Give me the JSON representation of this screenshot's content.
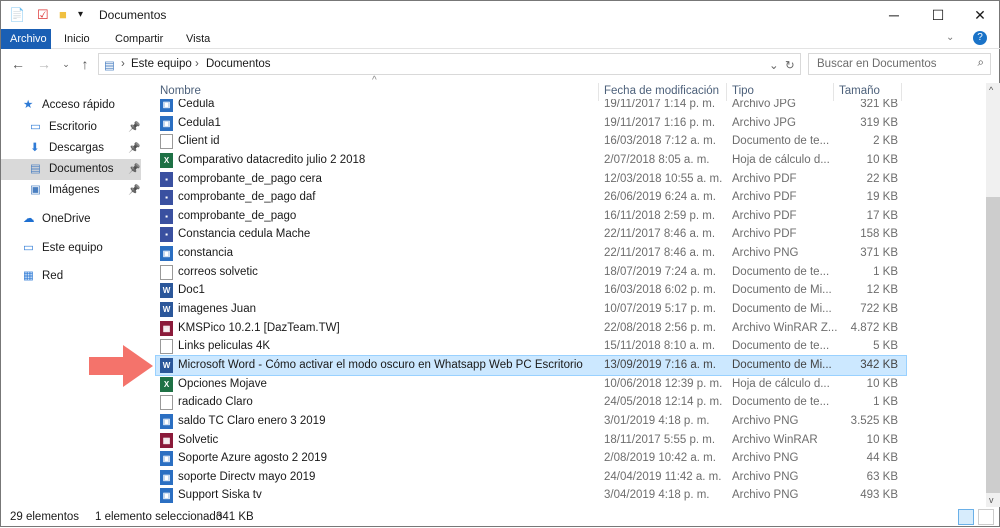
{
  "window": {
    "title": "Documentos",
    "minimize": "─",
    "maximize": "☐",
    "close": "✕",
    "help": "?"
  },
  "ribbon": {
    "tabs": [
      "Archivo",
      "Inicio",
      "Compartir",
      "Vista"
    ]
  },
  "address": {
    "crumbs": [
      "Este equipo",
      "Documentos"
    ],
    "search_placeholder": "Buscar en Documentos"
  },
  "sidebar": {
    "items": [
      {
        "label": "Acceso rápido",
        "icon": "star-icon"
      },
      {
        "label": "Escritorio",
        "icon": "desktop-icon",
        "pinned": true
      },
      {
        "label": "Descargas",
        "icon": "download-icon",
        "pinned": true
      },
      {
        "label": "Documentos",
        "icon": "documents-icon",
        "pinned": true,
        "selected": true
      },
      {
        "label": "Imágenes",
        "icon": "pictures-icon",
        "pinned": true
      },
      {
        "label": "OneDrive",
        "icon": "cloud-icon"
      },
      {
        "label": "Este equipo",
        "icon": "computer-icon"
      },
      {
        "label": "Red",
        "icon": "network-icon"
      }
    ]
  },
  "columns": {
    "name": "Nombre",
    "date": "Fecha de modificación",
    "type": "Tipo",
    "size": "Tamaño"
  },
  "files": [
    {
      "name": "Cedula",
      "date": "19/11/2017 1:14 p. m.",
      "type": "Archivo JPG",
      "size": "321 KB",
      "icon": "jpg"
    },
    {
      "name": "Cedula1",
      "date": "19/11/2017 1:16 p. m.",
      "type": "Archivo JPG",
      "size": "319 KB",
      "icon": "jpg"
    },
    {
      "name": "Client id",
      "date": "16/03/2018 7:12 a. m.",
      "type": "Documento de te...",
      "size": "2 KB",
      "icon": "txt"
    },
    {
      "name": "Comparativo datacredito julio 2 2018",
      "date": "2/07/2018 8:05 a. m.",
      "type": "Hoja de cálculo d...",
      "size": "10 KB",
      "icon": "xls"
    },
    {
      "name": "comprobante_de_pago cera",
      "date": "12/03/2018 10:55 a. m.",
      "type": "Archivo PDF",
      "size": "22 KB",
      "icon": "pdf"
    },
    {
      "name": "comprobante_de_pago daf",
      "date": "26/06/2019 6:24 a. m.",
      "type": "Archivo PDF",
      "size": "19 KB",
      "icon": "pdf"
    },
    {
      "name": "comprobante_de_pago",
      "date": "16/11/2018 2:59 p. m.",
      "type": "Archivo PDF",
      "size": "17 KB",
      "icon": "pdf"
    },
    {
      "name": "Constancia cedula Mache",
      "date": "22/11/2017 8:46 a. m.",
      "type": "Archivo PDF",
      "size": "158 KB",
      "icon": "pdf"
    },
    {
      "name": "constancia",
      "date": "22/11/2017 8:46 a. m.",
      "type": "Archivo PNG",
      "size": "371 KB",
      "icon": "png"
    },
    {
      "name": "correos solvetic",
      "date": "18/07/2019 7:24 a. m.",
      "type": "Documento de te...",
      "size": "1 KB",
      "icon": "txt"
    },
    {
      "name": "Doc1",
      "date": "16/03/2018 6:02 p. m.",
      "type": "Documento de Mi...",
      "size": "12 KB",
      "icon": "doc"
    },
    {
      "name": "imagenes Juan",
      "date": "10/07/2019 5:17 p. m.",
      "type": "Documento de Mi...",
      "size": "722 KB",
      "icon": "doc"
    },
    {
      "name": "KMSPico 10.2.1 [DazTeam.TW]",
      "date": "22/08/2018 2:56 p. m.",
      "type": "Archivo WinRAR Z...",
      "size": "4.872 KB",
      "icon": "rar"
    },
    {
      "name": "Links peliculas 4K",
      "date": "15/11/2018 8:10 a. m.",
      "type": "Documento de te...",
      "size": "5 KB",
      "icon": "txt"
    },
    {
      "name": "Microsoft Word - Cómo activar el modo oscuro en Whatsapp Web PC Escritorio",
      "date": "13/09/2019 7:16 a. m.",
      "type": "Documento de Mi...",
      "size": "342 KB",
      "icon": "doc",
      "selected": true
    },
    {
      "name": "Opciones Mojave",
      "date": "10/06/2018 12:39 p. m.",
      "type": "Hoja de cálculo d...",
      "size": "10 KB",
      "icon": "xls"
    },
    {
      "name": "radicado Claro",
      "date": "24/05/2018 12:14 p. m.",
      "type": "Documento de te...",
      "size": "1 KB",
      "icon": "txt"
    },
    {
      "name": "saldo TC Claro enero 3 2019",
      "date": "3/01/2019 4:18 p. m.",
      "type": "Archivo PNG",
      "size": "3.525 KB",
      "icon": "png"
    },
    {
      "name": "Solvetic",
      "date": "18/11/2017 5:55 p. m.",
      "type": "Archivo WinRAR",
      "size": "10 KB",
      "icon": "rar"
    },
    {
      "name": "Soporte Azure agosto 2 2019",
      "date": "2/08/2019 10:42 a. m.",
      "type": "Archivo PNG",
      "size": "44 KB",
      "icon": "png"
    },
    {
      "name": "soporte Directv mayo 2019",
      "date": "24/04/2019 11:42 a. m.",
      "type": "Archivo PNG",
      "size": "63 KB",
      "icon": "png"
    },
    {
      "name": "Support Siska tv",
      "date": "3/04/2019 4:18 p. m.",
      "type": "Archivo PNG",
      "size": "493 KB",
      "icon": "png"
    }
  ],
  "status": {
    "count": "29 elementos",
    "selection": "1 elemento seleccionado",
    "selection_size": "341 KB"
  },
  "colors": {
    "accent": "#1a5fb4",
    "selection": "#cce8ff",
    "arrow": "#f4736b"
  }
}
